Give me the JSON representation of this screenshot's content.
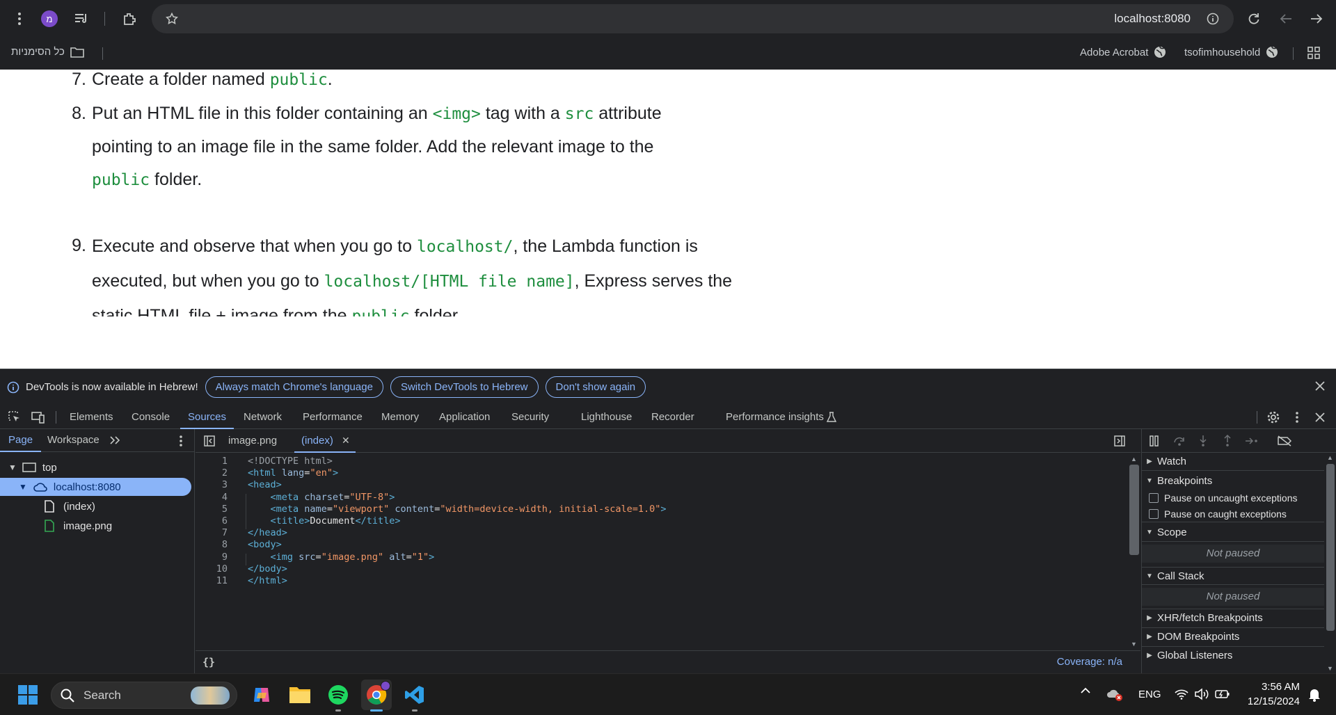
{
  "browser": {
    "url": "localhost:8080",
    "profile_initial": "מ",
    "bookmarks": {
      "all_bookmarks": "כל הסימניות",
      "items": [
        "Adobe Acrobat",
        "tsofimhousehold"
      ]
    }
  },
  "page": {
    "steps": [
      {
        "num": "7.",
        "parts": [
          {
            "t": "Create a folder named "
          },
          {
            "c": "public"
          },
          {
            "t": "."
          }
        ]
      },
      {
        "num": "8.",
        "parts": [
          {
            "t": "Put an HTML file in this folder containing an "
          },
          {
            "c": "<img>"
          },
          {
            "t": " tag with a "
          },
          {
            "c": "src"
          },
          {
            "t": " attribute pointing to an image file in the same folder. Add the relevant image to the "
          },
          {
            "c": "public"
          },
          {
            "t": " folder."
          }
        ]
      },
      {
        "num": "9.",
        "parts": [
          {
            "t": "Execute and observe that when you go to "
          },
          {
            "c": "localhost/"
          },
          {
            "t": ", the Lambda function is executed, but when you go to "
          },
          {
            "c": "localhost/[HTML file name]"
          },
          {
            "t": ", Express serves the static HTML file + image from the "
          },
          {
            "c": "public"
          },
          {
            "t": " folder."
          }
        ]
      }
    ]
  },
  "infobar": {
    "message": "DevTools is now available in Hebrew!",
    "buttons": [
      "Always match Chrome's language",
      "Switch DevTools to Hebrew",
      "Don't show again"
    ]
  },
  "devtools": {
    "tabs": [
      "Elements",
      "Console",
      "Sources",
      "Network",
      "Performance",
      "Memory",
      "Application",
      "Security",
      "Lighthouse",
      "Recorder",
      "Performance insights"
    ],
    "active_tab": "Sources",
    "navigator": {
      "tabs": [
        "Page",
        "Workspace"
      ],
      "tree": [
        "top",
        "localhost:8080",
        "(index)",
        "image.png"
      ]
    },
    "editor": {
      "tabs": [
        "image.png",
        "(index)"
      ],
      "lines": [
        [
          {
            "k": "cm",
            "t": "<!DOCTYPE html>"
          }
        ],
        [
          {
            "k": "tag",
            "t": "<html "
          },
          {
            "k": "attr",
            "t": "lang"
          },
          {
            "k": "txt",
            "t": "="
          },
          {
            "k": "val",
            "t": "\"en\""
          },
          {
            "k": "tag",
            "t": ">"
          }
        ],
        [
          {
            "k": "tag",
            "t": "<head>"
          }
        ],
        [
          {
            "k": "txt",
            "t": "    "
          },
          {
            "k": "tag",
            "t": "<meta "
          },
          {
            "k": "attr",
            "t": "charset"
          },
          {
            "k": "txt",
            "t": "="
          },
          {
            "k": "val",
            "t": "\"UTF-8\""
          },
          {
            "k": "tag",
            "t": ">"
          }
        ],
        [
          {
            "k": "txt",
            "t": "    "
          },
          {
            "k": "tag",
            "t": "<meta "
          },
          {
            "k": "attr",
            "t": "name"
          },
          {
            "k": "txt",
            "t": "="
          },
          {
            "k": "val",
            "t": "\"viewport\""
          },
          {
            "k": "txt",
            "t": " "
          },
          {
            "k": "attr",
            "t": "content"
          },
          {
            "k": "txt",
            "t": "="
          },
          {
            "k": "val",
            "t": "\"width=device-width, initial-scale=1.0\""
          },
          {
            "k": "tag",
            "t": ">"
          }
        ],
        [
          {
            "k": "txt",
            "t": "    "
          },
          {
            "k": "tag",
            "t": "<title>"
          },
          {
            "k": "txt",
            "t": "Document"
          },
          {
            "k": "tag",
            "t": "</title>"
          }
        ],
        [
          {
            "k": "tag",
            "t": "</head>"
          }
        ],
        [
          {
            "k": "tag",
            "t": "<body>"
          }
        ],
        [
          {
            "k": "txt",
            "t": "    "
          },
          {
            "k": "tag",
            "t": "<img "
          },
          {
            "k": "attr",
            "t": "src"
          },
          {
            "k": "txt",
            "t": "="
          },
          {
            "k": "val",
            "t": "\"image.png\""
          },
          {
            "k": "txt",
            "t": " "
          },
          {
            "k": "attr",
            "t": "alt"
          },
          {
            "k": "txt",
            "t": "="
          },
          {
            "k": "val",
            "t": "\"1\""
          },
          {
            "k": "tag",
            "t": ">"
          }
        ],
        [
          {
            "k": "tag",
            "t": "</body>"
          }
        ],
        [
          {
            "k": "tag",
            "t": "</html>"
          }
        ]
      ],
      "footer_left": "{}",
      "coverage": "Coverage: n/a"
    },
    "debugger": {
      "watch": "Watch",
      "breakpoints": "Breakpoints",
      "pause_uncaught": "Pause on uncaught exceptions",
      "pause_caught": "Pause on caught exceptions",
      "scope": "Scope",
      "not_paused": "Not paused",
      "call_stack": "Call Stack",
      "not_paused_2": "Not paused",
      "xhr": "XHR/fetch Breakpoints",
      "dom": "DOM Breakpoints",
      "global": "Global Listeners"
    }
  },
  "taskbar": {
    "search": "Search",
    "lang": "ENG",
    "time": "3:56 AM",
    "date": "12/15/2024"
  },
  "colors": {
    "accent": "#8ab4f8",
    "selected_row": "#8ab4f8",
    "code_green": "#1e8e3e"
  }
}
